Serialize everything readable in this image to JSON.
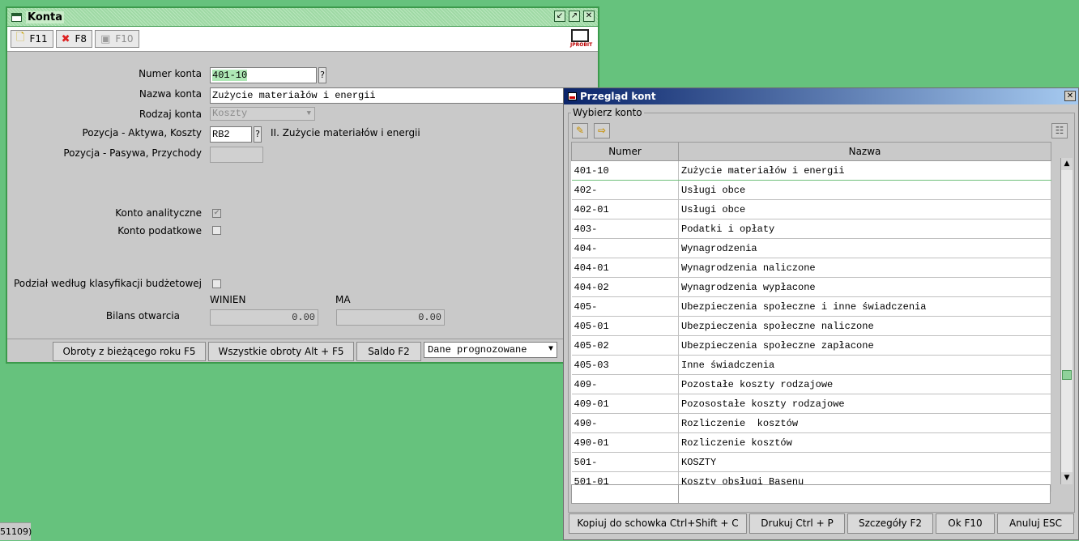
{
  "konta": {
    "title": "Konta",
    "toolbar": {
      "new_label": "F11",
      "delete_label": "F8",
      "save_label": "F10",
      "logo_text": "JPROBIT"
    },
    "form": {
      "numer_label": "Numer konta",
      "numer_value": "401-10",
      "nazwa_label": "Nazwa konta",
      "nazwa_value": "Zużycie materiałów i energii",
      "rodzaj_label": "Rodzaj konta",
      "rodzaj_value": "Koszty",
      "poz_aktywa_label": "Pozycja - Aktywa, Koszty",
      "poz_aktywa_value": "RB2",
      "poz_aktywa_desc": "II. Zużycie materiałów i energii",
      "poz_pasywa_label": "Pozycja - Pasywa, Przychody",
      "poz_pasywa_value": "",
      "analityczne_label": "Konto analityczne",
      "podatkowe_label": "Konto podatkowe",
      "podzial_label": "Podział według klasyfikacji budżetowej",
      "winien_header": "WINIEN",
      "ma_header": "MA",
      "bilans_label": "Bilans otwarcia",
      "winien_value": "0.00",
      "ma_value": "0.00",
      "help_mark": "?"
    },
    "buttons": {
      "obroty": "Obroty z bieżącego roku F5",
      "wszystkie": "Wszystkie obroty Alt + F5",
      "saldo": "Saldo F2",
      "combo_value": "Dane prognozowane"
    }
  },
  "przeglad": {
    "title": "Przegląd kont",
    "group_label": "Wybierz konto",
    "columns": [
      "Numer",
      "Nazwa"
    ],
    "rows": [
      [
        "401-10",
        "Zużycie materiałów i energii"
      ],
      [
        "402-",
        "Usługi obce"
      ],
      [
        "402-01",
        "Usługi obce"
      ],
      [
        "403-",
        "Podatki i opłaty"
      ],
      [
        "404-",
        "Wynagrodzenia"
      ],
      [
        "404-01",
        "Wynagrodzenia naliczone"
      ],
      [
        "404-02",
        "Wynagrodzenia wypłacone"
      ],
      [
        "405-",
        "Ubezpieczenia społeczne i inne świadczenia"
      ],
      [
        "405-01",
        "Ubezpieczenia społeczne naliczone"
      ],
      [
        "405-02",
        "Ubezpieczenia społeczne zapłacone"
      ],
      [
        "405-03",
        "Inne świadczenia"
      ],
      [
        "409-",
        "Pozostałe koszty rodzajowe"
      ],
      [
        "409-01",
        "Pozosostałe koszty rodzajowe"
      ],
      [
        "490-",
        "Rozliczenie  kosztów"
      ],
      [
        "490-01",
        "Rozliczenie kosztów"
      ],
      [
        "501-",
        "KOSZTY"
      ],
      [
        "501-01",
        "Koszty obsługi Basenu"
      ]
    ],
    "buttons": {
      "kopiuj": "Kopiuj do schowka Ctrl+Shift + C",
      "drukuj": "Drukuj Ctrl + P",
      "szczegoly": "Szczegóły F2",
      "ok": "Ok F10",
      "anuluj": "Anuluj ESC"
    }
  },
  "statusbar": {
    "text": "51109)"
  },
  "colors": {
    "desktop": "#66c27d",
    "window_bg": "#c9c9c9",
    "title_blue": "#0a246a"
  }
}
